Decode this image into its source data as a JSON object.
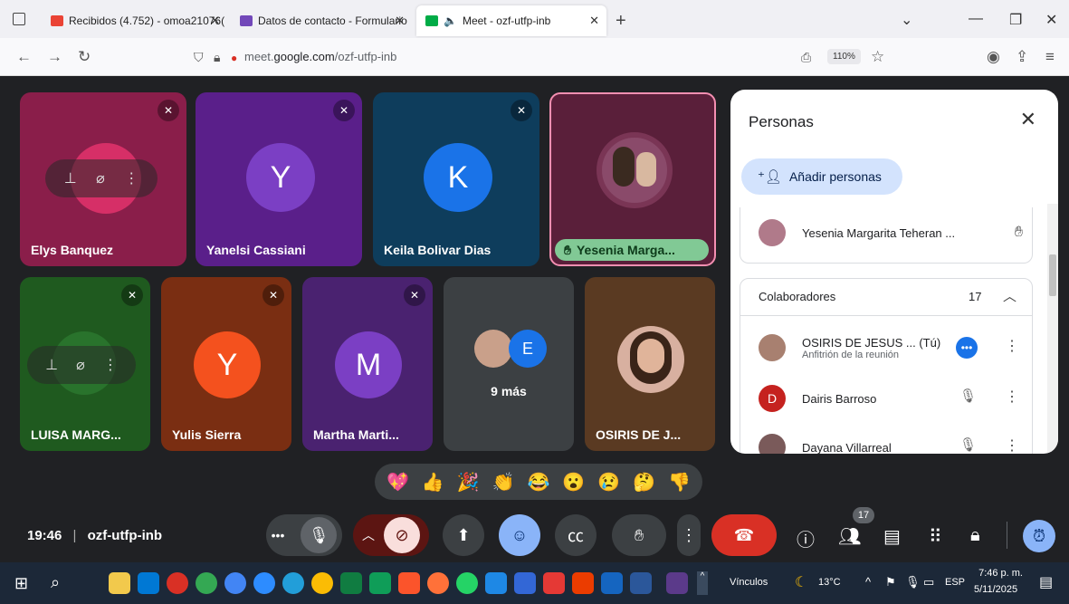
{
  "tabs": [
    {
      "label": "Recibidos (4.752) - omoa21076(",
      "icon": "gmail-icon",
      "color": "#ea4335"
    },
    {
      "label": "Datos de contacto - Formulario",
      "icon": "forms-icon",
      "color": "#7248b9"
    },
    {
      "label": "Meet - ozf-utfp-inb",
      "icon": "meet-icon",
      "color": "#00ac47"
    }
  ],
  "address": {
    "prefix": "meet.",
    "domain": "google.com",
    "path": "/ozf-utfp-inb",
    "zoom": "110%"
  },
  "tiles": [
    {
      "name": "Elys Banquez",
      "bg": "#8a1e4a",
      "kind": "tools"
    },
    {
      "name": "Yanelsi Cassiani",
      "bg": "#5a1f8a",
      "initial": "Y",
      "avatar_bg": "#7b3fc4"
    },
    {
      "name": "Keila Bolivar Dias",
      "bg": "#0e3d5c",
      "initial": "K",
      "avatar_bg": "#1a73e8"
    },
    {
      "name": "Yesenia Marga...",
      "bg": "#5a1f3a",
      "kind": "photo"
    },
    {
      "name": "LUISA MARG...",
      "bg": "#1f5a1f",
      "kind": "tools"
    },
    {
      "name": "Yulis Sierra",
      "bg": "#7a2e12",
      "initial": "Y",
      "avatar_bg": "#f4511e"
    },
    {
      "name": "Martha Marti...",
      "bg": "#4a2270",
      "initial": "M",
      "avatar_bg": "#7b3fc4"
    },
    {
      "name": "9 más",
      "bg": "#3c4043",
      "initial": "E",
      "avatar_bg": "#1a73e8"
    },
    {
      "name": "OSIRIS DE J...",
      "bg": "#5a3a22",
      "kind": "photo"
    }
  ],
  "panel": {
    "title": "Personas",
    "add_label": "Añadir personas",
    "hand_raised": "Yesenia Margarita Teheran ...",
    "section_label": "Colaboradores",
    "section_count": "17",
    "people": [
      {
        "name": "OSIRIS DE JESUS ...",
        "tag": "(Tú)",
        "sub": "Anfitrión de la reunión"
      },
      {
        "name": "Dairis Barroso",
        "initial": "D"
      },
      {
        "name": "Dayana Villarreal"
      }
    ]
  },
  "reactions": [
    "💖",
    "👍",
    "🎉",
    "👏",
    "😂",
    "😮",
    "😢",
    "🤔",
    "👎"
  ],
  "meeting": {
    "time": "19:46",
    "separator": "|",
    "code": "ozf-utfp-inb",
    "participants": "17"
  },
  "taskbar": {
    "links": "Vínculos",
    "temp": "13°C",
    "lang": "ESP",
    "time": "7:46 p. m.",
    "date": "5/11/2025"
  }
}
